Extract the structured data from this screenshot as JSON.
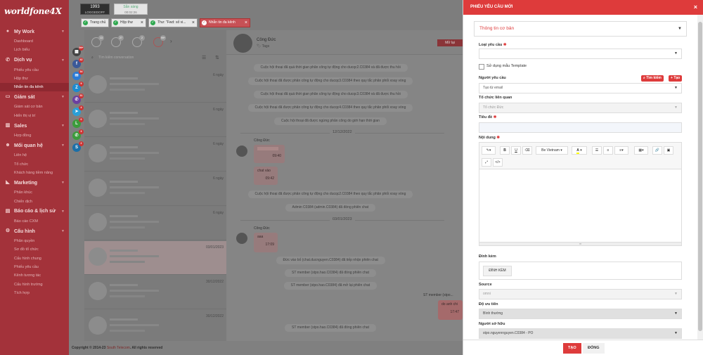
{
  "brand": {
    "logo": "worldfone4X"
  },
  "sidebar": {
    "sections": [
      {
        "title": "My Work",
        "icon": "user-icon",
        "items": [
          "Dashboard",
          "Lịch biểu"
        ]
      },
      {
        "title": "Dịch vụ",
        "icon": "phone-icon",
        "items": [
          "Phiếu yêu cầu",
          "Hộp thư",
          "Nhắn tin đa kênh"
        ]
      },
      {
        "title": "Giám sát",
        "icon": "monitor-icon",
        "items": [
          "Giám sát cơ bản",
          "Hiển thị vị trí"
        ]
      },
      {
        "title": "Sales",
        "icon": "chart-icon",
        "items": [
          "Hợp đồng"
        ]
      },
      {
        "title": "Mối quan hệ",
        "icon": "people-icon",
        "items": [
          "Liên hệ",
          "Tổ chức",
          "Khách hàng tiềm năng"
        ]
      },
      {
        "title": "Marketing",
        "icon": "megaphone-icon",
        "items": [
          "Phân khúc",
          "Chiến dịch"
        ]
      },
      {
        "title": "Báo cáo & lịch sử",
        "icon": "report-icon",
        "items": [
          "Báo cáo CXM"
        ]
      },
      {
        "title": "Cấu hình",
        "icon": "gear-icon",
        "items": [
          "Phân quyền",
          "Sơ đồ tổ chức",
          "Cấu hình chung",
          "Phiếu yêu cầu",
          "Kênh tương tác",
          "Cấu hình trường",
          "Tích hợp"
        ]
      }
    ],
    "active_item": "Nhắn tin đa kênh"
  },
  "topbar": {
    "extension": "1993",
    "extension_user": "LOGGEDOFF",
    "status": "Sẵn sàng",
    "timer": "00:02:26",
    "tabs": [
      "Trang chủ",
      "Hộp thư",
      "Thư: \"Fwd: số vi...",
      "Nhắn tin đa kênh"
    ]
  },
  "channels": {
    "badges": [
      "99+",
      "42",
      "34",
      "9",
      "31",
      "4",
      "0",
      "3",
      "2"
    ]
  },
  "convlist": {
    "badges": [
      "13",
      "27",
      "2",
      "99+"
    ],
    "search_placeholder": "Tìm kiếm conversation",
    "dates": [
      "6 ngày",
      "6 ngày",
      "6 ngày",
      "6 ngày",
      "6 ngày",
      "03/01/2023",
      "30/12/2022",
      "30/12/2022"
    ]
  },
  "chat": {
    "name": "Công Đức",
    "tag": "Tags",
    "open_button": "Mở lại",
    "system_top": [
      "Cuộc hội thoại đã quá thời gian phân công tự động cho ducqc2.C0384 và đã được thu hồi",
      "Cuộc hội thoại đã được phân công tự động cho ducqc3.C0384 theo quy tắc phân phối xoay vòng",
      "Cuộc hội thoại đã quá thời gian phân công tự động cho ducqc3.C0384 và đã được thu hồi",
      "Cuộc hội thoại đã được phân công tự động cho ducqc4.C0384 theo quy tắc phân phối xoay vòng",
      "Cuộc hội thoại đã được ngừng phân công do giới hạn thời gian"
    ],
    "date1": "12/12/2022",
    "sender": "Công Đức",
    "msg1_time": "09:40",
    "msg2_text": "chat vào",
    "msg2_time": "09:42",
    "system_mid": [
      "Cuộc hội thoại đã được phân công tự động cho ducqc2.C0384 theo quy tắc phân phối xoay vòng",
      "Admin C0384 (admin.C0384) đã đóng phiên chat"
    ],
    "date2": "03/01/2023",
    "msg3_text": "aaa",
    "msg3_time": "17:09",
    "system_bottom": [
      "Đức vào bố (chat.ducnguyen.C0384) đã tiếp nhận phiên chat",
      "ST member (stpo.hao.C0384) đã đóng phiên chat",
      "ST member (stpo.hao.C0384) đã mở lại phiên chat"
    ],
    "agent_label": "ST member (stpo...",
    "agent_msg": "do anh chi",
    "agent_time": "17:47",
    "system_last": "ST member (stpo.hao.C0384) đã đóng phiên chat"
  },
  "footer": {
    "text": "Copyright © 2014-23 ",
    "company": "South Telecom",
    "rights": ". All rights reserved"
  },
  "panel": {
    "title": "PHIẾU YÊU CẦU MỚI",
    "section": "Thông tin cơ bản",
    "request_type_label": "Loại yêu cầu",
    "template_label": "Sử dụng mẫu Template",
    "requester_label": "Người yêu cầu",
    "requester_placeholder": "Tạo từ email",
    "search_btn": "Tìm kiếm",
    "create_btn": "Tạo",
    "org_label": "Tổ chức liên quan",
    "org_placeholder": "Tổ chức Đức",
    "subject_label": "Tiêu đề",
    "content_label": "Nội dung",
    "editor": {
      "font_name": "Be Vietnam"
    },
    "attach_label": "Đính kèm",
    "attach_btn": "ĐÍNH KÈM",
    "source_label": "Source",
    "source_value": "omni",
    "priority_label": "Độ ưu tiên",
    "priority_value": "Bình thường",
    "owner_label": "Người sở hữu",
    "owner_value": "stpo.nguyennguyen.C0384 - PO",
    "submit": "TẠO",
    "close": "ĐÓNG"
  }
}
